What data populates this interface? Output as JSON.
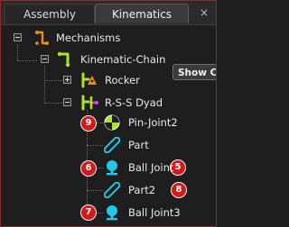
{
  "tabs": [
    {
      "label": "Assembly",
      "active": false
    },
    {
      "label": "Kinematics",
      "active": true
    }
  ],
  "close_glyph": "×",
  "tooltip": {
    "text": "Show Co"
  },
  "tree": {
    "mechanisms": {
      "label": "Mechanisms",
      "icon": "mechanism-icon",
      "expanded": true
    },
    "kinematic_chain": {
      "label": "Kinematic-Chain",
      "icon": "kinematic-chain-icon",
      "expanded": true
    },
    "rocker": {
      "label": "Rocker",
      "icon": "rocker-icon",
      "expanded": false
    },
    "rss_dyad": {
      "label": "R-S-S Dyad",
      "icon": "rss-dyad-icon",
      "expanded": true
    },
    "items": [
      {
        "label": "Pin-Joint2",
        "icon": "pin-joint-icon",
        "badge": "9"
      },
      {
        "label": "Part",
        "icon": "link-part-icon",
        "badge": "5"
      },
      {
        "label": "Ball Joint",
        "icon": "ball-joint-icon",
        "badge": "6"
      },
      {
        "label": "Part2",
        "icon": "link-part-icon",
        "badge": "8"
      },
      {
        "label": "Ball Joint3",
        "icon": "ball-joint-icon",
        "badge": "7"
      }
    ]
  },
  "colors": {
    "orange": "#f08c1e",
    "lime": "#a6e22e",
    "cyan": "#1ec8e6",
    "badge_red": "#d11a1a"
  }
}
